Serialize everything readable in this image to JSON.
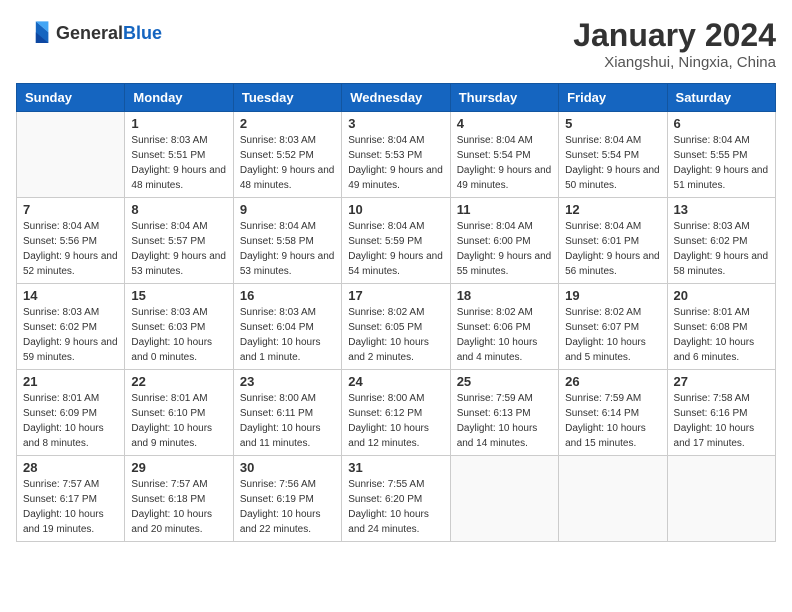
{
  "header": {
    "logo_general": "General",
    "logo_blue": "Blue",
    "title": "January 2024",
    "subtitle": "Xiangshui, Ningxia, China"
  },
  "columns": [
    "Sunday",
    "Monday",
    "Tuesday",
    "Wednesday",
    "Thursday",
    "Friday",
    "Saturday"
  ],
  "weeks": [
    [
      {
        "day": "",
        "empty": true
      },
      {
        "day": "1",
        "sunrise": "8:03 AM",
        "sunset": "5:51 PM",
        "daylight": "9 hours and 48 minutes."
      },
      {
        "day": "2",
        "sunrise": "8:03 AM",
        "sunset": "5:52 PM",
        "daylight": "9 hours and 48 minutes."
      },
      {
        "day": "3",
        "sunrise": "8:04 AM",
        "sunset": "5:53 PM",
        "daylight": "9 hours and 49 minutes."
      },
      {
        "day": "4",
        "sunrise": "8:04 AM",
        "sunset": "5:54 PM",
        "daylight": "9 hours and 49 minutes."
      },
      {
        "day": "5",
        "sunrise": "8:04 AM",
        "sunset": "5:54 PM",
        "daylight": "9 hours and 50 minutes."
      },
      {
        "day": "6",
        "sunrise": "8:04 AM",
        "sunset": "5:55 PM",
        "daylight": "9 hours and 51 minutes."
      }
    ],
    [
      {
        "day": "7",
        "sunrise": "8:04 AM",
        "sunset": "5:56 PM",
        "daylight": "9 hours and 52 minutes."
      },
      {
        "day": "8",
        "sunrise": "8:04 AM",
        "sunset": "5:57 PM",
        "daylight": "9 hours and 53 minutes."
      },
      {
        "day": "9",
        "sunrise": "8:04 AM",
        "sunset": "5:58 PM",
        "daylight": "9 hours and 53 minutes."
      },
      {
        "day": "10",
        "sunrise": "8:04 AM",
        "sunset": "5:59 PM",
        "daylight": "9 hours and 54 minutes."
      },
      {
        "day": "11",
        "sunrise": "8:04 AM",
        "sunset": "6:00 PM",
        "daylight": "9 hours and 55 minutes."
      },
      {
        "day": "12",
        "sunrise": "8:04 AM",
        "sunset": "6:01 PM",
        "daylight": "9 hours and 56 minutes."
      },
      {
        "day": "13",
        "sunrise": "8:03 AM",
        "sunset": "6:02 PM",
        "daylight": "9 hours and 58 minutes."
      }
    ],
    [
      {
        "day": "14",
        "sunrise": "8:03 AM",
        "sunset": "6:02 PM",
        "daylight": "9 hours and 59 minutes."
      },
      {
        "day": "15",
        "sunrise": "8:03 AM",
        "sunset": "6:03 PM",
        "daylight": "10 hours and 0 minutes."
      },
      {
        "day": "16",
        "sunrise": "8:03 AM",
        "sunset": "6:04 PM",
        "daylight": "10 hours and 1 minute."
      },
      {
        "day": "17",
        "sunrise": "8:02 AM",
        "sunset": "6:05 PM",
        "daylight": "10 hours and 2 minutes."
      },
      {
        "day": "18",
        "sunrise": "8:02 AM",
        "sunset": "6:06 PM",
        "daylight": "10 hours and 4 minutes."
      },
      {
        "day": "19",
        "sunrise": "8:02 AM",
        "sunset": "6:07 PM",
        "daylight": "10 hours and 5 minutes."
      },
      {
        "day": "20",
        "sunrise": "8:01 AM",
        "sunset": "6:08 PM",
        "daylight": "10 hours and 6 minutes."
      }
    ],
    [
      {
        "day": "21",
        "sunrise": "8:01 AM",
        "sunset": "6:09 PM",
        "daylight": "10 hours and 8 minutes."
      },
      {
        "day": "22",
        "sunrise": "8:01 AM",
        "sunset": "6:10 PM",
        "daylight": "10 hours and 9 minutes."
      },
      {
        "day": "23",
        "sunrise": "8:00 AM",
        "sunset": "6:11 PM",
        "daylight": "10 hours and 11 minutes."
      },
      {
        "day": "24",
        "sunrise": "8:00 AM",
        "sunset": "6:12 PM",
        "daylight": "10 hours and 12 minutes."
      },
      {
        "day": "25",
        "sunrise": "7:59 AM",
        "sunset": "6:13 PM",
        "daylight": "10 hours and 14 minutes."
      },
      {
        "day": "26",
        "sunrise": "7:59 AM",
        "sunset": "6:14 PM",
        "daylight": "10 hours and 15 minutes."
      },
      {
        "day": "27",
        "sunrise": "7:58 AM",
        "sunset": "6:16 PM",
        "daylight": "10 hours and 17 minutes."
      }
    ],
    [
      {
        "day": "28",
        "sunrise": "7:57 AM",
        "sunset": "6:17 PM",
        "daylight": "10 hours and 19 minutes."
      },
      {
        "day": "29",
        "sunrise": "7:57 AM",
        "sunset": "6:18 PM",
        "daylight": "10 hours and 20 minutes."
      },
      {
        "day": "30",
        "sunrise": "7:56 AM",
        "sunset": "6:19 PM",
        "daylight": "10 hours and 22 minutes."
      },
      {
        "day": "31",
        "sunrise": "7:55 AM",
        "sunset": "6:20 PM",
        "daylight": "10 hours and 24 minutes."
      },
      {
        "day": "",
        "empty": true
      },
      {
        "day": "",
        "empty": true
      },
      {
        "day": "",
        "empty": true
      }
    ]
  ],
  "labels": {
    "sunrise_prefix": "Sunrise: ",
    "sunset_prefix": "Sunset: ",
    "daylight_prefix": "Daylight: "
  }
}
